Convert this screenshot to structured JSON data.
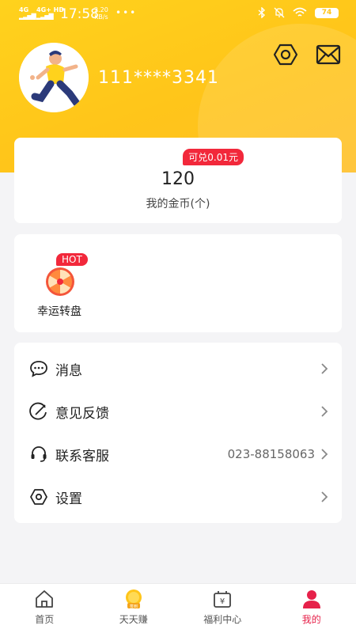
{
  "status_bar": {
    "net1": "4G",
    "net2": "4G+ HD",
    "time": "17:58",
    "speed_value": "2.20",
    "speed_unit": "KB/s",
    "dots": "•••",
    "battery": "74"
  },
  "profile": {
    "username": "111****3341",
    "settings_icon": "hexagon-settings-icon",
    "message_icon": "envelope-icon"
  },
  "coins": {
    "badge": "可兑0.01元",
    "value": "120",
    "label": "我的金币(个)"
  },
  "activities": {
    "hot_badge": "HOT",
    "wheel_label": "幸运转盘"
  },
  "menu": {
    "items": [
      {
        "label": "消息",
        "value": "",
        "icon": "chat-bubble-icon"
      },
      {
        "label": "意见反馈",
        "value": "",
        "icon": "feedback-icon"
      },
      {
        "label": "联系客服",
        "value": "023-88158063",
        "icon": "headset-icon"
      },
      {
        "label": "设置",
        "value": "",
        "icon": "settings-icon"
      }
    ]
  },
  "tabs": [
    {
      "label": "首页",
      "icon": "home-icon"
    },
    {
      "label": "天天赚",
      "icon": "coin-checkin-icon"
    },
    {
      "label": "福利中心",
      "icon": "welfare-icon"
    },
    {
      "label": "我的",
      "icon": "person-icon"
    }
  ],
  "colors": {
    "header": "#ffc51a",
    "accent_red": "#f2283b",
    "active_tab": "#e6214a"
  }
}
